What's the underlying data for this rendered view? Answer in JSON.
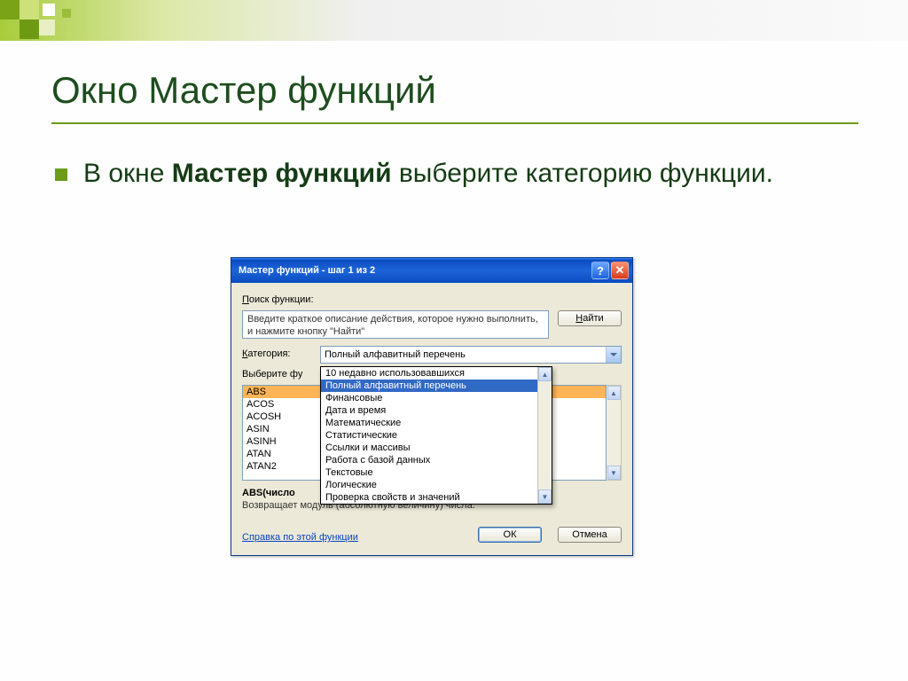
{
  "slide": {
    "title": "Окно Мастер функций",
    "bullet_prefix": "В окне ",
    "bullet_bold": "Мастер функций",
    "bullet_suffix": " выберите категорию функции."
  },
  "dialog": {
    "title": "Мастер функций - шаг 1 из 2",
    "help_char": "?",
    "close_char": "✕",
    "search_label_u": "П",
    "search_label_rest": "оиск функции:",
    "search_text": "Введите краткое описание действия, которое нужно выполнить, и нажмите кнопку \"Найти\"",
    "find_btn_u": "Н",
    "find_btn_rest": "айти",
    "category_label_u": "К",
    "category_label_rest": "атегория:",
    "category_value": "Полный алфавитный перечень",
    "select_label_prefix": "Выберите фу",
    "functions": [
      "ABS",
      "ACOS",
      "ACOSH",
      "ASIN",
      "ASINH",
      "ATAN",
      "ATAN2"
    ],
    "signature": "ABS(число",
    "description": "Возвращает модуль (абсолютную величину) числа.",
    "help_link": "Справка по этой функции",
    "ok": "ОК",
    "cancel": "Отмена"
  },
  "dropdown": {
    "items": [
      "10 недавно использовавшихся",
      "Полный алфавитный перечень",
      "Финансовые",
      "Дата и время",
      "Математические",
      "Статистические",
      "Ссылки и массивы",
      "Работа с базой данных",
      "Текстовые",
      "Логические",
      "Проверка свойств и значений"
    ],
    "selected_index": 1
  }
}
